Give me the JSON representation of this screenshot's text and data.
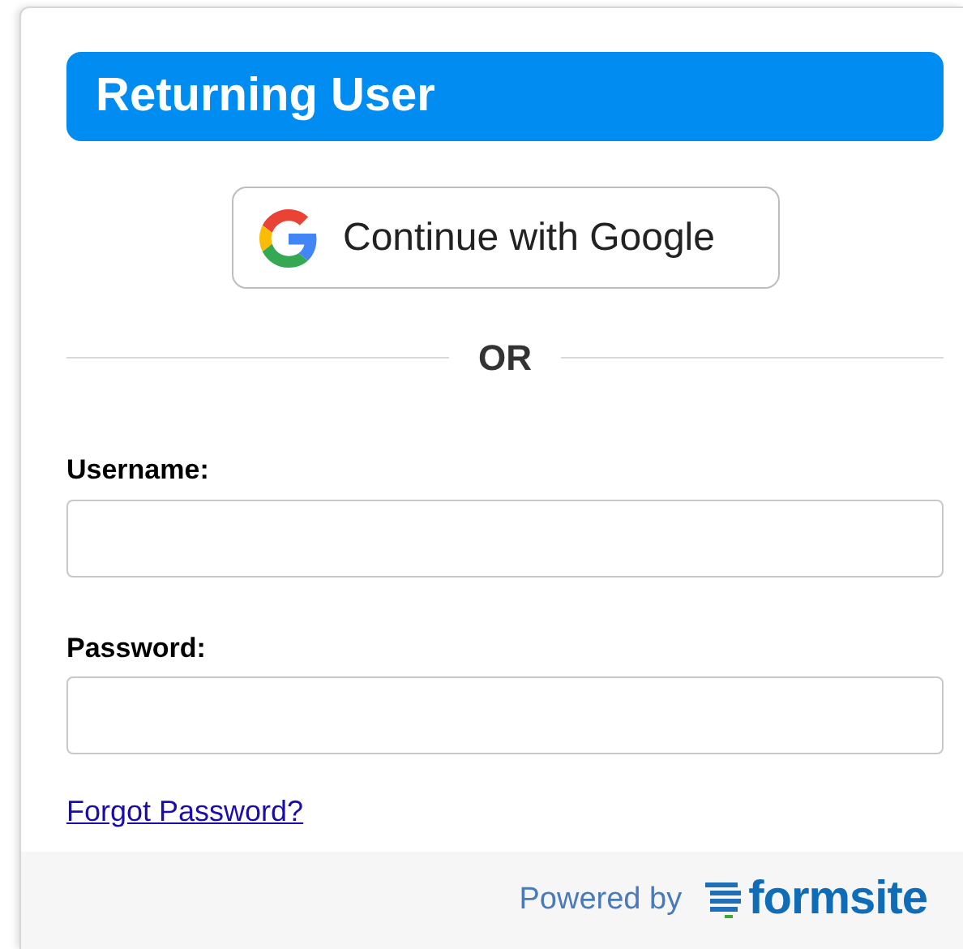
{
  "header": {
    "title": "Returning User"
  },
  "google_button": {
    "label": "Continue with Google"
  },
  "divider": {
    "label": "OR"
  },
  "fields": [
    {
      "label": "Username:"
    },
    {
      "label": "Password:"
    }
  ],
  "forgot_link": "Forgot Password?",
  "footer": {
    "powered_by": "Powered by",
    "brand": "formsite"
  }
}
